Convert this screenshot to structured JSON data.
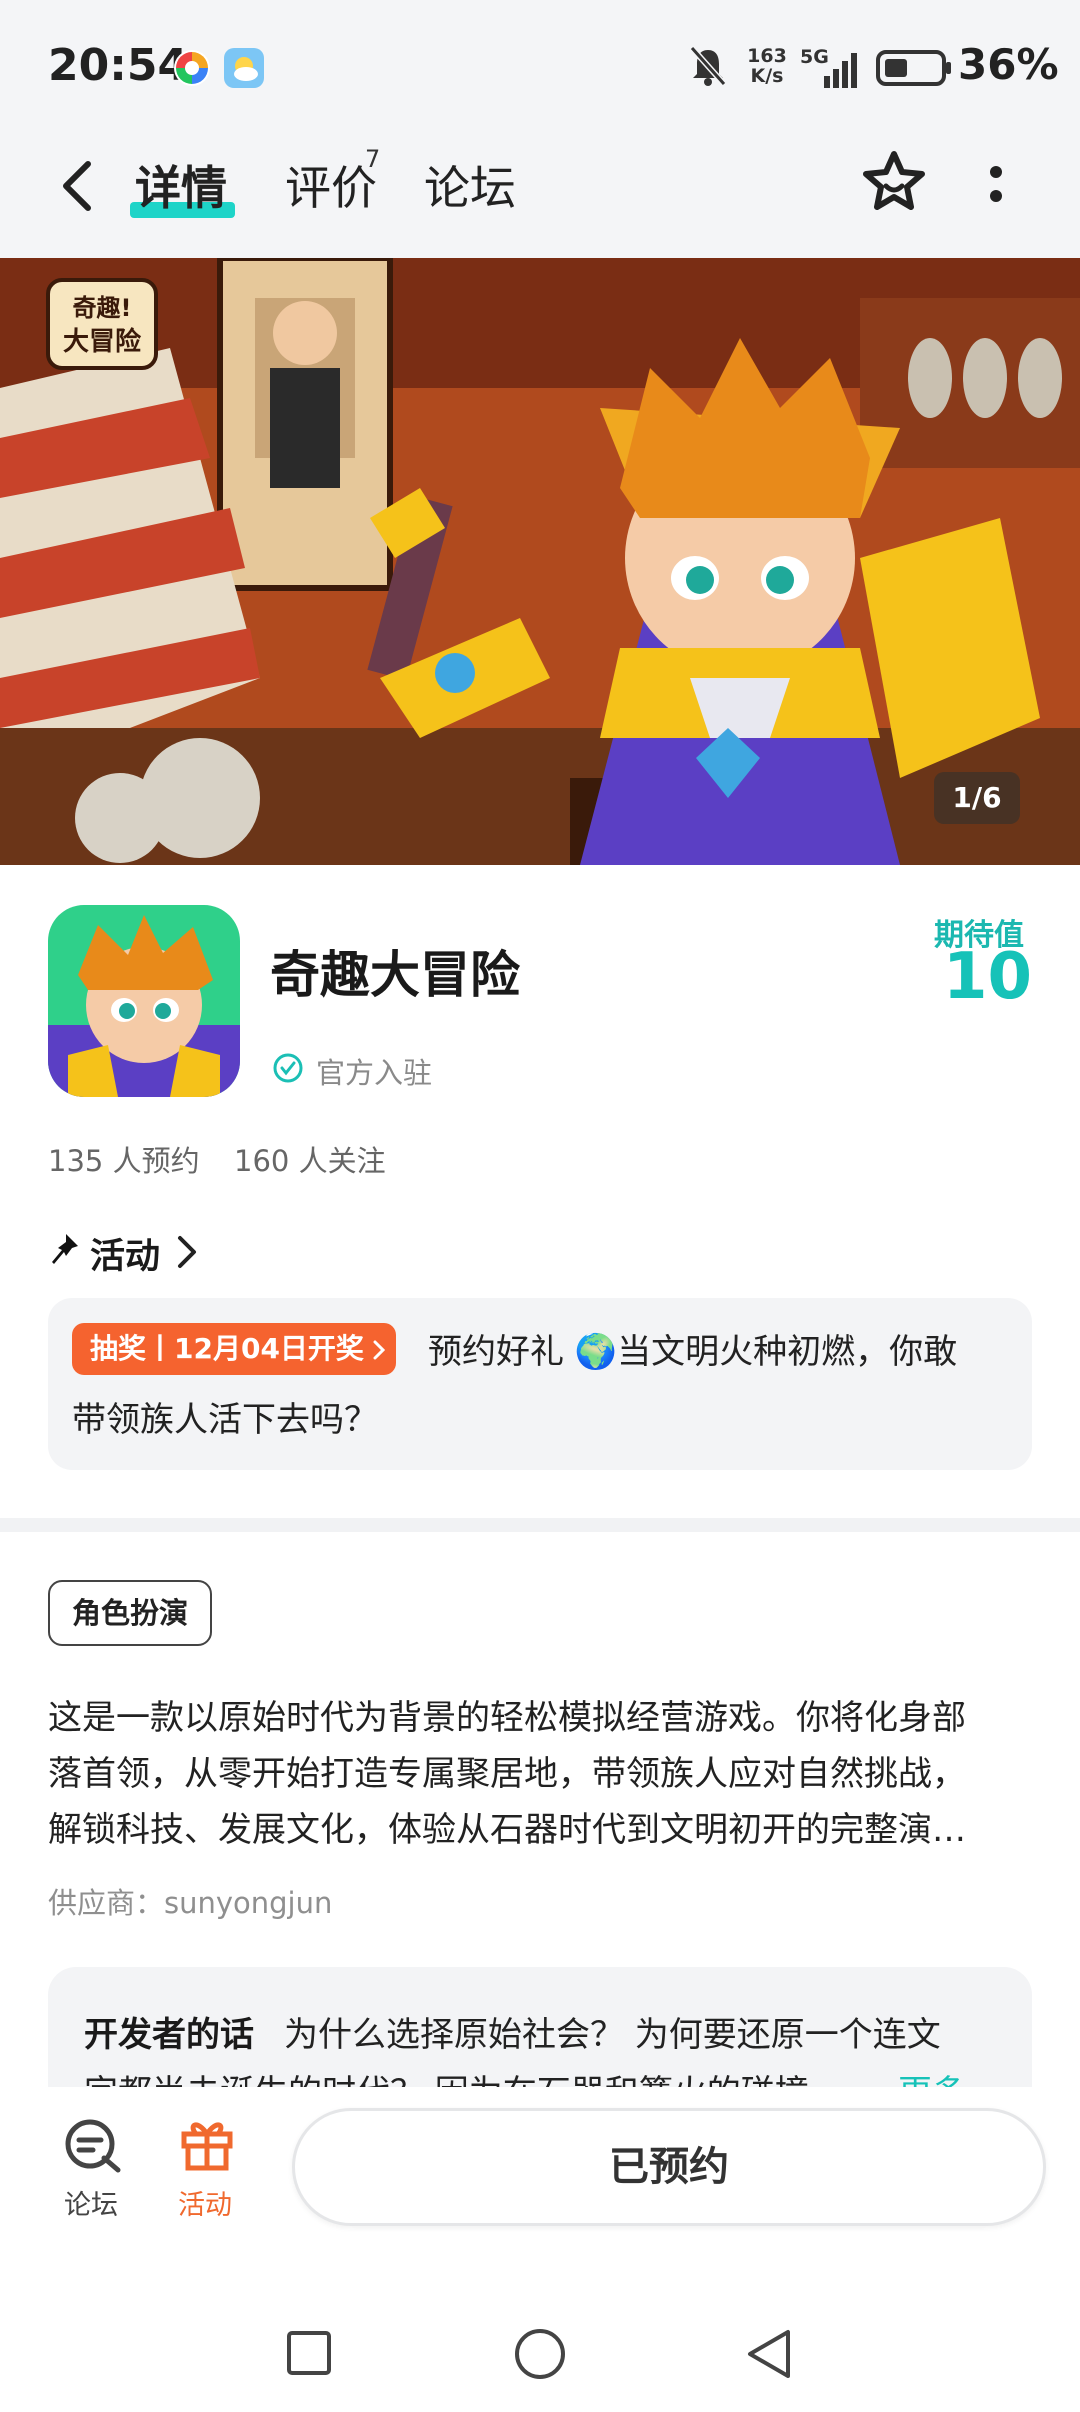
{
  "status_bar": {
    "time": "20:54",
    "net_speed_value": "163",
    "net_speed_unit": "K/s",
    "signal_label": "5G",
    "battery_percent": "36%"
  },
  "header": {
    "tabs": [
      {
        "label": "详情",
        "active": true
      },
      {
        "label": "评价",
        "badge": "7"
      },
      {
        "label": "论坛"
      }
    ]
  },
  "banner": {
    "page_indicator": "1/6",
    "logo_text": "奇趣!大冒险"
  },
  "app": {
    "title": "奇趣大冒险",
    "official_label": "官方入驻",
    "expect_label": "期待值",
    "expect_value": "10",
    "reserve_count": "135 人预约",
    "follow_count": "160 人关注"
  },
  "activity": {
    "title": "活动",
    "badge": "抽奖丨12月04日开奖",
    "line1": "预约好礼 🌍当文明火种初燃，你敢",
    "line2": "带领族人活下去吗？"
  },
  "description": {
    "genre_tag": "角色扮演",
    "line1": "这是一款以原始时代为背景的轻松模拟经营游戏。你将化身部",
    "line2": "落首领，从零开始打造专属聚居地，带领族人应对自然挑战，",
    "line3": "解锁科技、发展文化，体验从石器时代到文明初开的完整演…",
    "supplier": "供应商：sunyongjun"
  },
  "developer_note": {
    "title": "开发者的话",
    "text": "为什么选择原始社会？ 为何要还原一个连文",
    "text2": "字都尚未诞生的时代？ 因为在石器和篝火的碰撞",
    "more": "更多"
  },
  "bottom_bar": {
    "forum_label": "论坛",
    "activity_label": "活动",
    "reserve_button": "已预约"
  },
  "colors": {
    "accent_teal": "#16c2b8",
    "accent_orange": "#f0692e"
  }
}
